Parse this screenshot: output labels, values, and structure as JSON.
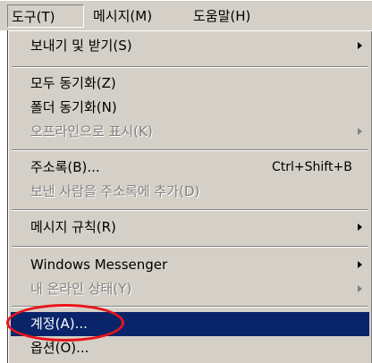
{
  "menubar": {
    "tools": "도구(T)",
    "message": "메시지(M)",
    "help": "도움말(H)"
  },
  "menu": {
    "send_receive": "보내기 및 받기(S)",
    "sync_all": "모두 동기화(Z)",
    "sync_folder": "폴더 동기화(N)",
    "offline": "오프라인으로 표시(K)",
    "address_book": "주소록(B)...",
    "address_book_shortcut": "Ctrl+Shift+B",
    "add_sender": "보낸 사람을 주소록에 추가(D)",
    "message_rules": "메시지 규칙(R)",
    "windows_messenger": "Windows Messenger",
    "online_status": "내 온라인 상태(Y)",
    "accounts": "계정(A)...",
    "options": "옵션(O)..."
  },
  "colors": {
    "menu_bg": "#d4d0c8",
    "highlight": "#0a246a",
    "annotation": "#e8141a"
  }
}
